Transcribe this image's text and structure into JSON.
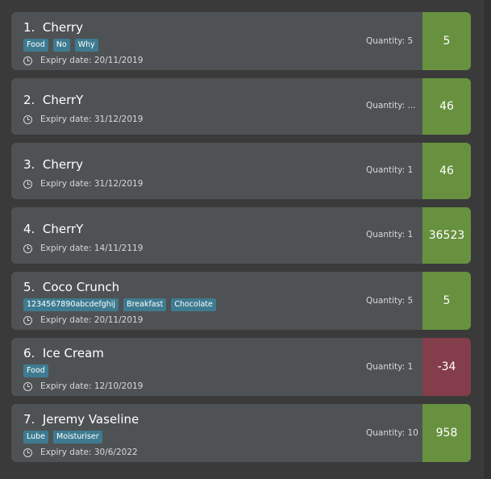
{
  "items": [
    {
      "index": "1.",
      "name": "Cherry",
      "tags": [
        "Food",
        "No",
        "Why"
      ],
      "expiry": "Expiry date: 20/11/2019",
      "quantity": "Quantity: 5",
      "days": "5",
      "status": "good"
    },
    {
      "index": "2.",
      "name": "CherrY",
      "tags": [],
      "expiry": "Expiry date: 31/12/2019",
      "quantity": "Quantity: ...",
      "days": "46",
      "status": "good"
    },
    {
      "index": "3.",
      "name": "Cherry",
      "tags": [],
      "expiry": "Expiry date: 31/12/2019",
      "quantity": "Quantity: 1",
      "days": "46",
      "status": "good"
    },
    {
      "index": "4.",
      "name": "CherrY",
      "tags": [],
      "expiry": "Expiry date: 14/11/2119",
      "quantity": "Quantity: 1",
      "days": "36523",
      "status": "good"
    },
    {
      "index": "5.",
      "name": "Coco Crunch",
      "tags": [
        "1234567890abcdefghij",
        "Breakfast",
        "Chocolate"
      ],
      "expiry": "Expiry date: 20/11/2019",
      "quantity": "Quantity: 5",
      "days": "5",
      "status": "good"
    },
    {
      "index": "6.",
      "name": "Ice Cream",
      "tags": [
        "Food"
      ],
      "expiry": "Expiry date: 12/10/2019",
      "quantity": "Quantity: 1",
      "days": "-34",
      "status": "bad"
    },
    {
      "index": "7.",
      "name": "Jeremy Vaseline",
      "tags": [
        "Lube",
        "Moisturiser"
      ],
      "expiry": "Expiry date: 30/6/2022",
      "quantity": "Quantity: 10",
      "days": "958",
      "status": "good"
    }
  ],
  "colors": {
    "background": "#3a3a3a",
    "card": "#4f5254",
    "tag": "#3e7b91",
    "good": "#67913f",
    "bad": "#843d4b"
  },
  "icons": {
    "expiry": "clock-icon"
  }
}
